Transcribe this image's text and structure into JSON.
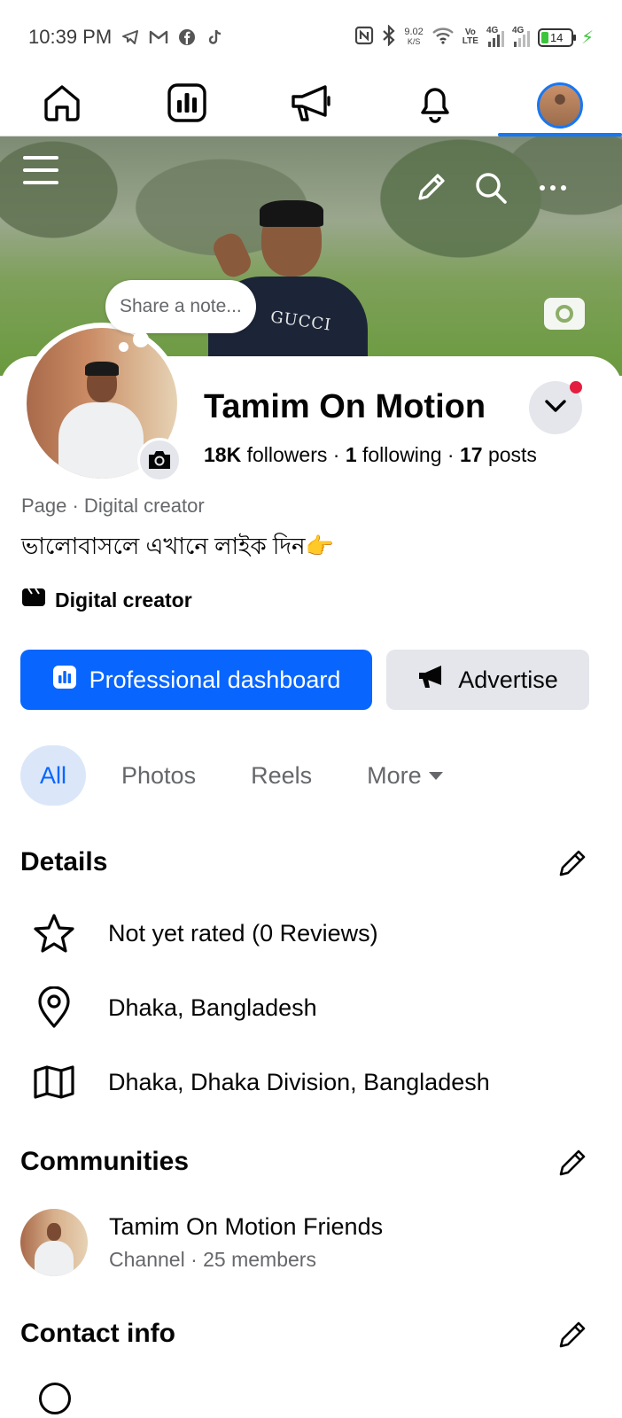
{
  "status_bar": {
    "time": "10:39 PM",
    "left_icons": [
      "telegram-icon",
      "gmail-icon",
      "facebook-icon",
      "tiktok-icon"
    ],
    "net_speed": "9.02",
    "net_speed_unit": "K/S",
    "volte_top": "Vo",
    "volte_bottom": "LTE",
    "sig1_label": "4G",
    "sig2_label": "4G",
    "battery": "14"
  },
  "nav": {
    "tabs": [
      "home",
      "professional-dashboard",
      "advertise",
      "notifications",
      "profile"
    ],
    "active": "profile"
  },
  "cover": {
    "shirt_text": "GUCCI"
  },
  "note": {
    "placeholder": "Share a note..."
  },
  "profile": {
    "name": "Tamim On Motion",
    "followers_count": "18K",
    "followers_label": "followers",
    "following_count": "1",
    "following_label": "following",
    "posts_count": "17",
    "posts_label": "posts",
    "category": "Page · Digital creator",
    "bio": "ভালোবাসলে এখানে লাইক দিন👉",
    "creator_label": "Digital creator"
  },
  "actions": {
    "professional_dashboard": "Professional dashboard",
    "advertise": "Advertise"
  },
  "filters": {
    "all": "All",
    "photos": "Photos",
    "reels": "Reels",
    "more": "More"
  },
  "details": {
    "title": "Details",
    "rating": "Not yet rated (0 Reviews)",
    "location": "Dhaka, Bangladesh",
    "address": "Dhaka, Dhaka Division, Bangladesh"
  },
  "communities": {
    "title": "Communities",
    "name": "Tamim On Motion Friends",
    "subtitle": "Channel · 25 members"
  },
  "contact": {
    "title": "Contact info"
  },
  "colors": {
    "accent": "#0866ff",
    "active_chip_bg": "#dbe7f9",
    "notification_dot": "#e41e3f"
  }
}
